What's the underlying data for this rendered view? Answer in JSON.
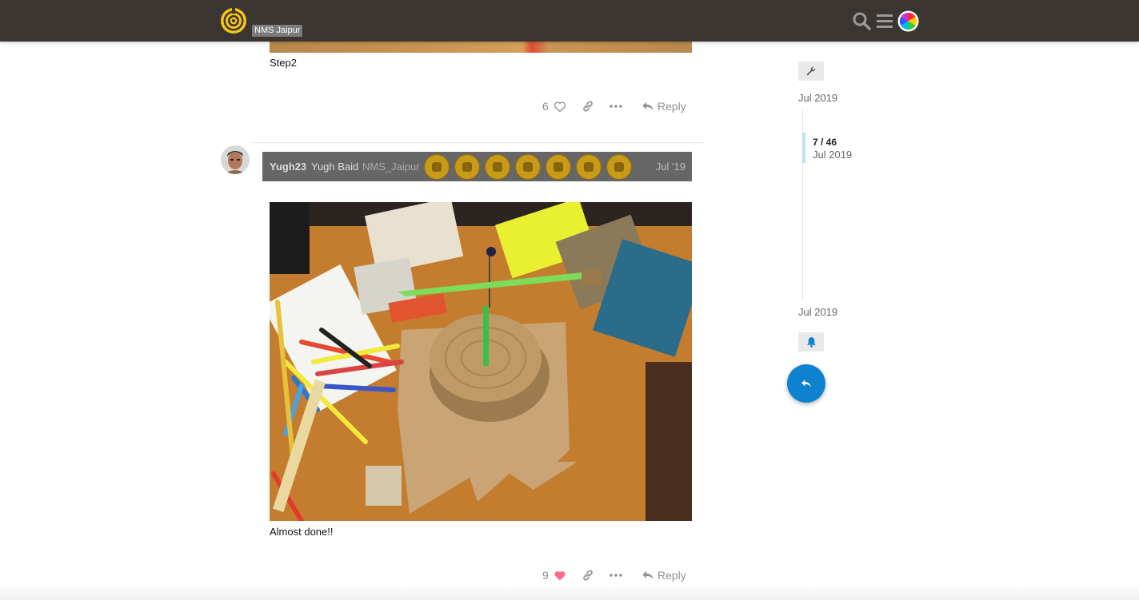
{
  "header": {
    "site_badge": "NMS Jaipur",
    "icons": [
      "logo-icon",
      "search-icon",
      "hamburger-menu-icon",
      "user-avatar"
    ]
  },
  "posts": [
    {
      "caption": "Step2",
      "likes": "6",
      "liked": false,
      "reply_label": "Reply"
    },
    {
      "username": "Yugh23",
      "full_name": "Yugh Baid",
      "group": "NMS_Jaipur",
      "badge_count": 7,
      "date": "Jul '19",
      "caption": "Almost done!!",
      "likes": "9",
      "liked": true,
      "reply_label": "Reply"
    }
  ],
  "timeline": {
    "start_date": "Jul 2019",
    "position": "7 / 46",
    "position_date": "Jul 2019",
    "end_date": "Jul 2019"
  },
  "colors": {
    "header_bg": "#3b3532",
    "accent_blue": "#0f82cf",
    "like_pink": "#fa6c8d",
    "logo_yellow": "#f5c518"
  }
}
